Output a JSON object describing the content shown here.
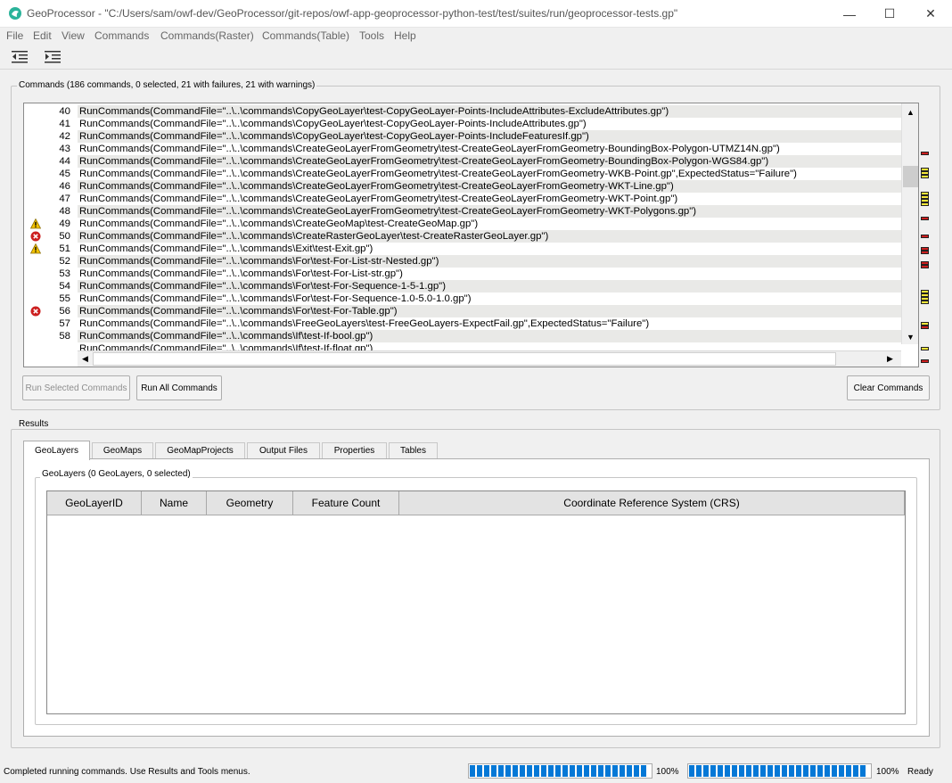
{
  "window": {
    "title": "GeoProcessor - \"C:/Users/sam/owf-dev/GeoProcessor/git-repos/owf-app-geoprocessor-python-test/test/suites/run/geoprocessor-tests.gp\"",
    "minimize_glyph": "—",
    "maximize_glyph": "☐",
    "close_glyph": "✕"
  },
  "menu": [
    "File",
    "Edit",
    "View",
    "Commands",
    "Commands(Raster)",
    "Commands(Table)",
    "Tools",
    "Help"
  ],
  "commands_group": {
    "label": "Commands (186 commands, 0 selected, 21 with failures, 21 with warnings)",
    "rows": [
      {
        "num": "40",
        "text": "RunCommands(CommandFile=\"..\\..\\commands\\CopyGeoLayer\\test-CopyGeoLayer-Points-IncludeAttributes-ExcludeAttributes.gp\")",
        "status": ""
      },
      {
        "num": "41",
        "text": "RunCommands(CommandFile=\"..\\..\\commands\\CopyGeoLayer\\test-CopyGeoLayer-Points-IncludeAttributes.gp\")",
        "status": ""
      },
      {
        "num": "42",
        "text": "RunCommands(CommandFile=\"..\\..\\commands\\CopyGeoLayer\\test-CopyGeoLayer-Points-IncludeFeaturesIf.gp\")",
        "status": ""
      },
      {
        "num": "43",
        "text": "RunCommands(CommandFile=\"..\\..\\commands\\CreateGeoLayerFromGeometry\\test-CreateGeoLayerFromGeometry-BoundingBox-Polygon-UTMZ14N.gp\")",
        "status": ""
      },
      {
        "num": "44",
        "text": "RunCommands(CommandFile=\"..\\..\\commands\\CreateGeoLayerFromGeometry\\test-CreateGeoLayerFromGeometry-BoundingBox-Polygon-WGS84.gp\")",
        "status": ""
      },
      {
        "num": "45",
        "text": "RunCommands(CommandFile=\"..\\..\\commands\\CreateGeoLayerFromGeometry\\test-CreateGeoLayerFromGeometry-WKB-Point.gp\",ExpectedStatus=\"Failure\")",
        "status": ""
      },
      {
        "num": "46",
        "text": "RunCommands(CommandFile=\"..\\..\\commands\\CreateGeoLayerFromGeometry\\test-CreateGeoLayerFromGeometry-WKT-Line.gp\")",
        "status": ""
      },
      {
        "num": "47",
        "text": "RunCommands(CommandFile=\"..\\..\\commands\\CreateGeoLayerFromGeometry\\test-CreateGeoLayerFromGeometry-WKT-Point.gp\")",
        "status": ""
      },
      {
        "num": "48",
        "text": "RunCommands(CommandFile=\"..\\..\\commands\\CreateGeoLayerFromGeometry\\test-CreateGeoLayerFromGeometry-WKT-Polygons.gp\")",
        "status": ""
      },
      {
        "num": "49",
        "text": "RunCommands(CommandFile=\"..\\..\\commands\\CreateGeoMap\\test-CreateGeoMap.gp\")",
        "status": "warning"
      },
      {
        "num": "50",
        "text": "RunCommands(CommandFile=\"..\\..\\commands\\CreateRasterGeoLayer\\test-CreateRasterGeoLayer.gp\")",
        "status": "failure"
      },
      {
        "num": "51",
        "text": "RunCommands(CommandFile=\"..\\..\\commands\\Exit\\test-Exit.gp\")",
        "status": "warning"
      },
      {
        "num": "52",
        "text": "RunCommands(CommandFile=\"..\\..\\commands\\For\\test-For-List-str-Nested.gp\")",
        "status": ""
      },
      {
        "num": "53",
        "text": "RunCommands(CommandFile=\"..\\..\\commands\\For\\test-For-List-str.gp\")",
        "status": ""
      },
      {
        "num": "54",
        "text": "RunCommands(CommandFile=\"..\\..\\commands\\For\\test-For-Sequence-1-5-1.gp\")",
        "status": ""
      },
      {
        "num": "55",
        "text": "RunCommands(CommandFile=\"..\\..\\commands\\For\\test-For-Sequence-1.0-5.0-1.0.gp\")",
        "status": ""
      },
      {
        "num": "56",
        "text": "RunCommands(CommandFile=\"..\\..\\commands\\For\\test-For-Table.gp\")",
        "status": "failure"
      },
      {
        "num": "57",
        "text": "RunCommands(CommandFile=\"..\\..\\commands\\FreeGeoLayers\\test-FreeGeoLayers-ExpectFail.gp\",ExpectedStatus=\"Failure\")",
        "status": ""
      },
      {
        "num": "58",
        "text": "RunCommands(CommandFile=\"..\\..\\commands\\If\\test-If-bool.gp\")",
        "status": ""
      },
      {
        "num": "",
        "text": "RunCommands(CommandFile=\"..\\..\\commands\\If\\test-If-float.gp\")",
        "status": ""
      }
    ],
    "overview_marks": [
      {
        "status": "failure"
      },
      {
        "status": "warning"
      },
      {
        "status": "warning"
      },
      {
        "status": "warning"
      },
      {
        "status": "warning"
      },
      {
        "status": "warning"
      },
      {
        "status": "warning"
      },
      {
        "status": "warning"
      },
      {
        "status": "failure"
      },
      {
        "status": "failure"
      },
      {
        "status": "failure"
      },
      {
        "status": "failure"
      },
      {
        "status": "failure"
      },
      {
        "status": "failure"
      },
      {
        "status": "warning"
      },
      {
        "status": "warning"
      },
      {
        "status": "warning"
      },
      {
        "status": "warning"
      },
      {
        "status": "warning"
      },
      {
        "status": "failure"
      },
      {
        "status": "warning"
      },
      {
        "status": "failure"
      }
    ],
    "buttons": {
      "run_selected": "Run Selected Commands",
      "run_all": "Run All Commands",
      "clear": "Clear Commands"
    }
  },
  "results_group": {
    "label": "Results",
    "tabs": [
      "GeoLayers",
      "GeoMaps",
      "GeoMapProjects",
      "Output Files",
      "Properties",
      "Tables"
    ],
    "active_tab": "GeoLayers",
    "geolayers_label": "GeoLayers (0 GeoLayers, 0 selected)",
    "columns": [
      "GeoLayerID",
      "Name",
      "Geometry",
      "Feature Count",
      "Coordinate Reference System (CRS)"
    ]
  },
  "status_bar": {
    "message": "Completed running commands. Use Results and Tools menus.",
    "progress1": "100%",
    "progress2": "100%",
    "state": "Ready"
  },
  "colors": {
    "failure": "#cc1f1f",
    "warning": "#f5e63a",
    "progress": "#0578d6"
  }
}
